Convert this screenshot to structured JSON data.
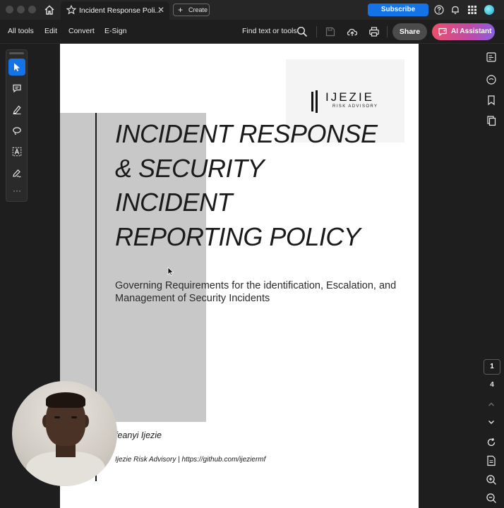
{
  "window": {
    "tab_title": "Incident Response Poli...",
    "create_label": "Create",
    "subscribe_label": "Subscribe"
  },
  "menubar": {
    "items": [
      "All tools",
      "Edit",
      "Convert",
      "E-Sign"
    ],
    "find_label": "Find text or tools",
    "share_label": "Share",
    "ai_label": "AI Assistant"
  },
  "tools": [
    "select-tool",
    "comment-tool",
    "highlight-tool",
    "draw-tool",
    "text-select-tool",
    "sign-tool",
    "more-tools"
  ],
  "document": {
    "logo_name": "IJEZIE",
    "logo_sub": "RISK ADVISORY",
    "title_lines": [
      "INCIDENT RESPONSE",
      "& SECURITY",
      "INCIDENT",
      "REPORTING POLICY"
    ],
    "subtitle": "Governing Requirements for the identification, Escalation, and Management of Security Incidents",
    "author": "feanyi Ijezie",
    "affiliation": "Ijezie Risk Advisory | https://github.com/ijeziermf"
  },
  "pagination": {
    "current_page": "1",
    "total_pages": "4"
  },
  "colors": {
    "accent": "#1473e6",
    "background": "#1e1e1e"
  }
}
